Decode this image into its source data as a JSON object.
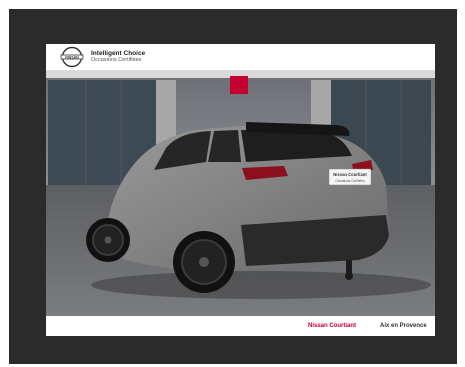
{
  "banner": {
    "title": "Intelligent Choice",
    "subtitle": "Occasions Certifiées",
    "logo_word": "NISSAN"
  },
  "plate": {
    "line1": "Nissan Courtiant",
    "line2": "Occasions Certifiées"
  },
  "footer": {
    "dealer": "Nissan Courtiant",
    "city": "Aix en Provence"
  },
  "colors": {
    "accent": "#c3002f",
    "car_body": "#8a8a8a",
    "background_frame": "#2b2b2b"
  },
  "icons": {
    "logo": "nissan-logo-icon"
  }
}
